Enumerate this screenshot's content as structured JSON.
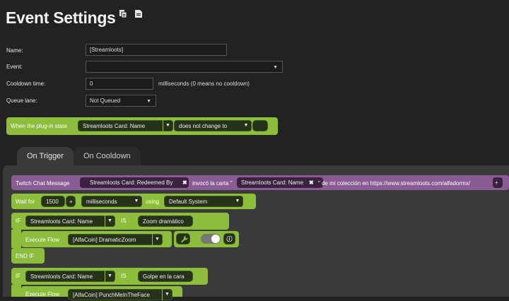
{
  "header": {
    "title": "Event Settings",
    "icons": [
      "copy-icon",
      "paste-icon"
    ]
  },
  "form": {
    "name_label": "Name:",
    "name_value": "[Streamloots]",
    "event_label": "Event:",
    "event_value": "",
    "cooldown_label": "Cooldown time:",
    "cooldown_value": "0",
    "cooldown_note": "milliseconds (0 means no cooldown)",
    "queue_label": "Queue lane:",
    "queue_value": "Not Queued"
  },
  "plugin_state": {
    "prefix": "When the plug-in state",
    "variable": "Streamloots Card: Name",
    "condition": "does not change to",
    "value": ""
  },
  "tabs": [
    "On Trigger",
    "On Cooldown"
  ],
  "twitch": {
    "label": "Twitch Chat Message",
    "token1": "Streamloots Card: Redeemed By",
    "text1": "invocó la carta \"",
    "token2": "Streamloots Card: Name",
    "text2": "\" de mi colección en https://www.streamloots.com/alfadormx/",
    "plus": "+"
  },
  "wait": {
    "label": "Wait for",
    "amount": "1500",
    "plus": "+",
    "unit": "milliseconds",
    "using": "using",
    "system": "Default System"
  },
  "if1": {
    "if_label": "IF",
    "variable": "Streamloots Card: Name",
    "is": "IS",
    "value": "Zoom dramático",
    "exec_label": "Execute Flow",
    "flow": "[AlfaCoin] DramaticZoom",
    "end": "END IF"
  },
  "if2": {
    "if_label": "IF",
    "variable": "Streamloots Card: Name",
    "is": "IS",
    "value": "Golpe en la cara",
    "exec_label": "Execute Flow",
    "flow": "[AlfaCoin] PunchMeInTheFace"
  },
  "colors": {
    "green": "#8cbe3c",
    "purple": "#8a5c93",
    "background": "#222222"
  }
}
